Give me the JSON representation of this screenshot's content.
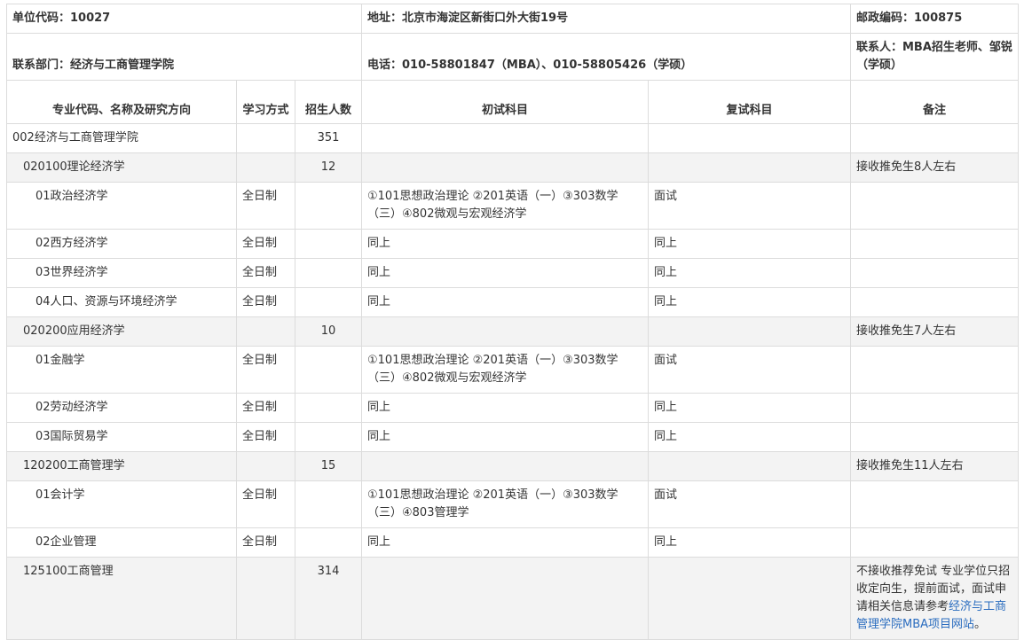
{
  "info": {
    "unit_code": "单位代码：10027",
    "address": "地址：北京市海淀区新街口外大街19号",
    "postcode": "邮政编码：100875",
    "dept": "联系部门：经济与工商管理学院",
    "phone": "电话：010-58801847（MBA）、010-58805426（学硕）",
    "contact": "联系人：MBA招生老师、邹锐（学硕）"
  },
  "headers": [
    "专业代码、名称及研究方向",
    "学习方式",
    "招生人数",
    "初试科目",
    "复试科目",
    "备注"
  ],
  "rows": [
    {
      "name": "002经济与工商管理学院",
      "mode": "",
      "count": "351",
      "exam": "",
      "retest": "",
      "note": ""
    },
    {
      "name": "020100理论经济学",
      "mode": "",
      "count": "12",
      "exam": "",
      "retest": "",
      "note": "接收推免生8人左右"
    },
    {
      "name": "01政治经济学",
      "mode": "全日制",
      "count": "",
      "exam": "①101思想政治理论 ②201英语（一）③303数学（三）④802微观与宏观经济学",
      "retest": "面试",
      "note": ""
    },
    {
      "name": "02西方经济学",
      "mode": "全日制",
      "count": "",
      "exam": "同上",
      "retest": "同上",
      "note": ""
    },
    {
      "name": "03世界经济学",
      "mode": "全日制",
      "count": "",
      "exam": "同上",
      "retest": "同上",
      "note": ""
    },
    {
      "name": "04人口、资源与环境经济学",
      "mode": "全日制",
      "count": "",
      "exam": "同上",
      "retest": "同上",
      "note": ""
    },
    {
      "name": "020200应用经济学",
      "mode": "",
      "count": "10",
      "exam": "",
      "retest": "",
      "note": "接收推免生7人左右"
    },
    {
      "name": "01金融学",
      "mode": "全日制",
      "count": "",
      "exam": "①101思想政治理论 ②201英语（一）③303数学（三）④802微观与宏观经济学",
      "retest": "面试",
      "note": ""
    },
    {
      "name": "02劳动经济学",
      "mode": "全日制",
      "count": "",
      "exam": "同上",
      "retest": "同上",
      "note": ""
    },
    {
      "name": "03国际贸易学",
      "mode": "全日制",
      "count": "",
      "exam": "同上",
      "retest": "同上",
      "note": ""
    },
    {
      "name": "120200工商管理学",
      "mode": "",
      "count": "15",
      "exam": "",
      "retest": "",
      "note": "接收推免生11人左右"
    },
    {
      "name": "01会计学",
      "mode": "全日制",
      "count": "",
      "exam": "①101思想政治理论 ②201英语（一）③303数学（三）④803管理学",
      "retest": "面试",
      "note": ""
    },
    {
      "name": "02企业管理",
      "mode": "全日制",
      "count": "",
      "exam": "同上",
      "retest": "同上",
      "note": ""
    },
    {
      "name": "125100工商管理",
      "mode": "",
      "count": "314",
      "exam": "",
      "retest": "",
      "note_text": "不接收推荐免试 专业学位只招收定向生，提前面试，面试申请相关信息请参考",
      "note_link": "经济与工商管理学院MBA项目网站",
      "note_end": "。"
    }
  ]
}
